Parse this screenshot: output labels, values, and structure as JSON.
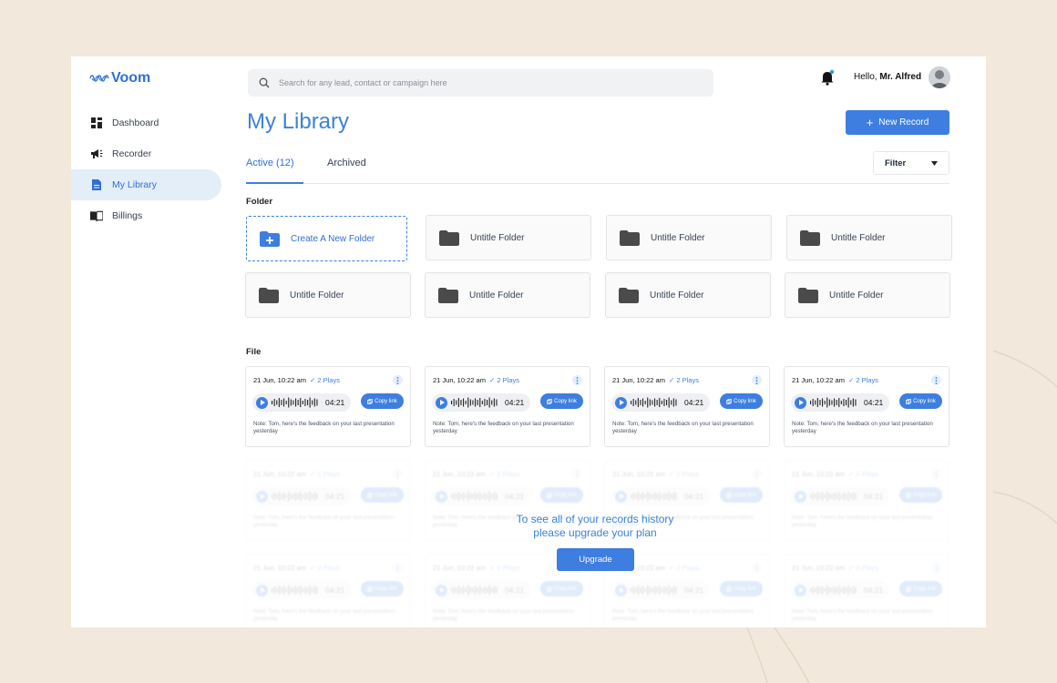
{
  "app": {
    "logo_text": "Voom",
    "brand_color": "#3d7ee0"
  },
  "sidebar": {
    "items": [
      {
        "label": "Dashboard",
        "icon": "dashboard-icon",
        "active": false
      },
      {
        "label": "Recorder",
        "icon": "megaphone-icon",
        "active": false
      },
      {
        "label": "My Library",
        "icon": "document-icon",
        "active": true
      },
      {
        "label": "Billings",
        "icon": "book-icon",
        "active": false
      }
    ]
  },
  "header": {
    "search_placeholder": "Search for any lead, contact or campaign here",
    "greeting_prefix": "Hello,",
    "user_name": "Mr. Alfred"
  },
  "main": {
    "title": "My Library",
    "new_record_label": "New Record",
    "tabs": [
      {
        "label": "Active (12)",
        "active": true
      },
      {
        "label": "Archived",
        "active": false
      }
    ],
    "filter_label": "Filter",
    "folder_section_label": "Folder",
    "create_folder_label": "Create A New Folder",
    "folders": [
      "Untitle Folder",
      "Untitle Folder",
      "Untitle Folder",
      "Untitle Folder",
      "Untitle Folder",
      "Untitle Folder",
      "Untitle Folder"
    ],
    "file_section_label": "File",
    "file_card": {
      "date": "21 Jun, 10:22 am",
      "plays": "2 Plays",
      "duration": "04:21",
      "copy_label": "Copy link",
      "note": "Note: Tom, here's the feedback on your last presentation yesterday"
    },
    "upgrade": {
      "message_line1": "To see all of your records history",
      "message_line2": "please upgrade your plan",
      "button_label": "Upgrade"
    }
  }
}
